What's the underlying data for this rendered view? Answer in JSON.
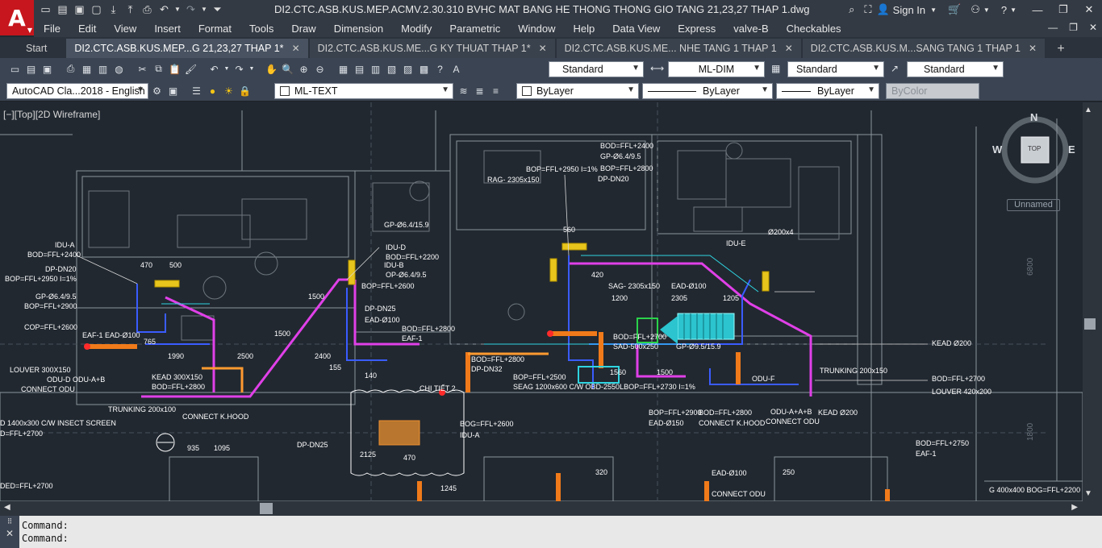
{
  "app": {
    "logo": "A"
  },
  "titlebar": {
    "title": "DI2.CTC.ASB.KUS.MEP.ACMV.2.30.310 BVHC MAT BANG HE THONG THONG GIO TANG 21,23,27 THAP 1.dwg",
    "sign_in": "Sign In"
  },
  "menu": [
    "File",
    "Edit",
    "View",
    "Insert",
    "Format",
    "Tools",
    "Draw",
    "Dimension",
    "Modify",
    "Parametric",
    "Window",
    "Help",
    "Data View",
    "Express",
    "valve-B",
    "Checkables"
  ],
  "tabs": [
    {
      "label": "Start"
    },
    {
      "label": "DI2.CTC.ASB.KUS.MEP...G 21,23,27 THAP 1*"
    },
    {
      "label": "DI2.CTC.ASB.KUS.ME...G KY THUAT THAP 1*"
    },
    {
      "label": "DI2.CTC.ASB.KUS.ME... NHE TANG 1 THAP 1"
    },
    {
      "label": "DI2.CTC.ASB.KUS.M...SANG TANG 1 THAP 1"
    }
  ],
  "toolbar1": {
    "text_style": "Standard",
    "dim_style": "ML-DIM",
    "table_style": "Standard",
    "mleader_style": "Standard"
  },
  "toolbar2": {
    "workspace": "AutoCAD Cla...2018 - English",
    "layer": "ML-TEXT",
    "color": "ByLayer",
    "linetype": "ByLayer",
    "lineweight": "ByLayer",
    "plot_style": "ByColor"
  },
  "viewport": {
    "label": "[−][Top][2D Wireframe]",
    "viewcube": {
      "n": "N",
      "s": "S",
      "e": "E",
      "w": "W",
      "top": "TOP"
    },
    "ucs": "Unnamed"
  },
  "drawing_labels": [
    "IDU-A",
    "BOD=FFL+2400",
    "DP-DN20",
    "BOP=FFL+2950 I=1%",
    "GP-Ø6.4/9.5",
    "BOP=FFL+2900",
    "COP=FFL+2600",
    "EAF-1 EAD-Ø100",
    "LOUVER 300X150",
    "ODU-D  ODU-A+B",
    "CONNECT ODU",
    "KEAD 300X150",
    "BOD=FFL+2800",
    "TRUNKING 200x100",
    "CONNECT K.HOOD",
    "D 1400x300 C/W INSECT SCREEN",
    "D=FFL+2700",
    "GP-Ø6.4/15.9",
    "IDU-D",
    "BOD=FFL+2200",
    "IDU-B",
    "OP-Ø6.4/9.5",
    "BOP=FFL+2600",
    "DP-DN25",
    "EAD-Ø100",
    "BOD=FFL+2800",
    "EAF-1",
    "CHI TIẾT 2",
    "DP-DN25",
    "BOP=FFL+2950 I=1%",
    "RAG- 2305x150",
    "SAG- 2305x150",
    "EAD-Ø100",
    "BOD=FFL+2800",
    "DP-DN32",
    "BOP=FFL+2500",
    "SEAG 1200x600 C/W OBD-2550LBOP=FFL+2730 I=1%",
    "BOG=FFL+2600",
    "IDU-A",
    "BOD=FFL+2400",
    "GP-Ø6.4/9.5",
    "BOP=FFL+2800",
    "DP-DN20",
    "Ø200x4",
    "IDU-E",
    "BOD=FFL+2700",
    "SAD-500x250",
    "GP-Ø9.5/15.9",
    "BOP=FFL+2900",
    "EAD-Ø150",
    "BOD=FFL+2800",
    "CONNECT K.HOOD",
    "KEAD Ø200",
    "TRUNKING 200x150",
    "BOD=FFL+2700",
    "LOUVER 420x200",
    "ODU-F",
    "ODU-A+A+B",
    "CONNECT ODU",
    "KEAD Ø200",
    "BOD=FFL+2750",
    "EAF-1",
    "EAD-Ø100",
    "CONNECT ODU",
    "G 400x400 BOG=FFL+2200",
    "DED=FFL+2700"
  ],
  "dimensions": [
    "470",
    "500",
    "1500",
    "1500",
    "560",
    "420",
    "1200",
    "2305",
    "1205",
    "2400",
    "2500",
    "1990",
    "765",
    "155",
    "140",
    "2125",
    "470",
    "1560",
    "1500",
    "250",
    "935",
    "1095",
    "320",
    "1245"
  ],
  "side_dims": [
    "6800",
    "1800"
  ],
  "command": {
    "line1": "Command:",
    "line2": "Command:"
  }
}
